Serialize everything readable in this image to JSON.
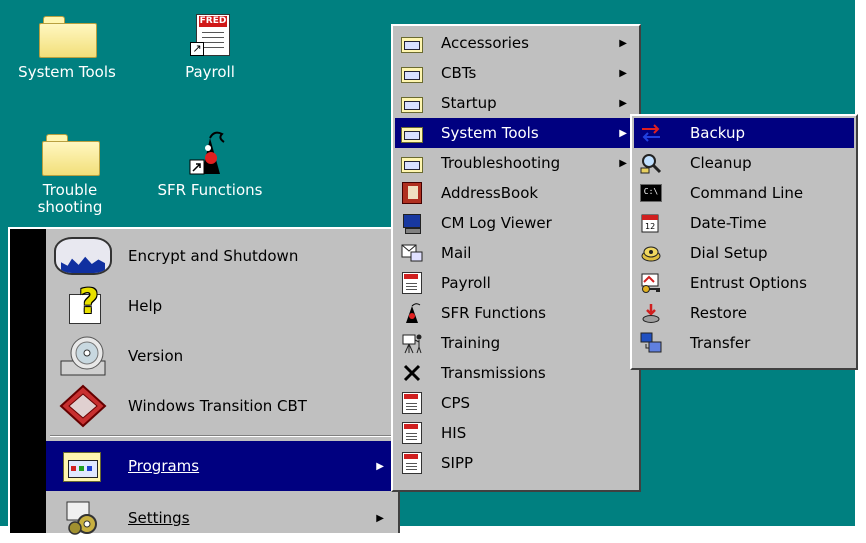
{
  "desktop": {
    "icons": [
      {
        "label": "System Tools",
        "icon": "folder-icon"
      },
      {
        "label": "Payroll",
        "icon": "payroll-document-icon",
        "badge_text": "FRED"
      },
      {
        "label": "Trouble shooting",
        "icon": "folder-icon"
      },
      {
        "label": "SFR Functions",
        "icon": "sfr-functions-icon"
      }
    ],
    "background_color": "#008080"
  },
  "start_menu": {
    "items": [
      {
        "label": "Encrypt and Shutdown",
        "icon": "shutdown-icon"
      },
      {
        "label": "Help",
        "icon": "help-icon"
      },
      {
        "label": "Version",
        "icon": "cd-drive-icon"
      },
      {
        "label": "Windows Transition CBT",
        "icon": "transition-cbt-icon"
      },
      {
        "label": "Programs",
        "icon": "programs-folder-icon",
        "highlighted": true,
        "has_submenu": true
      },
      {
        "label": "Settings",
        "icon": "settings-icon",
        "has_submenu": true
      }
    ]
  },
  "programs_menu": {
    "items": [
      {
        "label": "Accessories",
        "icon": "program-group-icon",
        "has_submenu": true
      },
      {
        "label": "CBTs",
        "icon": "program-group-icon",
        "has_submenu": true
      },
      {
        "label": "Startup",
        "icon": "program-group-icon",
        "has_submenu": true
      },
      {
        "label": "System Tools",
        "icon": "program-group-icon",
        "has_submenu": true,
        "highlighted": true
      },
      {
        "label": "Troubleshooting",
        "icon": "program-group-icon",
        "has_submenu": true
      },
      {
        "label": "AddressBook",
        "icon": "address-book-icon"
      },
      {
        "label": "CM Log Viewer",
        "icon": "monitor-icon"
      },
      {
        "label": "Mail",
        "icon": "mail-icon"
      },
      {
        "label": "Payroll",
        "icon": "payroll-icon"
      },
      {
        "label": "SFR Functions",
        "icon": "sfr-functions-icon"
      },
      {
        "label": "Training",
        "icon": "training-icon"
      },
      {
        "label": "Transmissions",
        "icon": "transmissions-icon"
      },
      {
        "label": "CPS",
        "icon": "cps-icon"
      },
      {
        "label": "HIS",
        "icon": "his-icon"
      },
      {
        "label": "SIPP",
        "icon": "sipp-icon"
      }
    ]
  },
  "system_tools_menu": {
    "items": [
      {
        "label": "Backup",
        "icon": "backup-icon",
        "highlighted": true
      },
      {
        "label": "Cleanup",
        "icon": "cleanup-icon"
      },
      {
        "label": "Command Line",
        "icon": "command-line-icon"
      },
      {
        "label": "Date-Time",
        "icon": "date-time-icon"
      },
      {
        "label": "Dial Setup",
        "icon": "dial-setup-icon"
      },
      {
        "label": "Entrust Options",
        "icon": "entrust-key-icon"
      },
      {
        "label": "Restore",
        "icon": "restore-icon"
      },
      {
        "label": "Transfer",
        "icon": "transfer-icon"
      }
    ]
  },
  "colors": {
    "highlight": "#000080",
    "menu_face": "#c0c0c0"
  }
}
